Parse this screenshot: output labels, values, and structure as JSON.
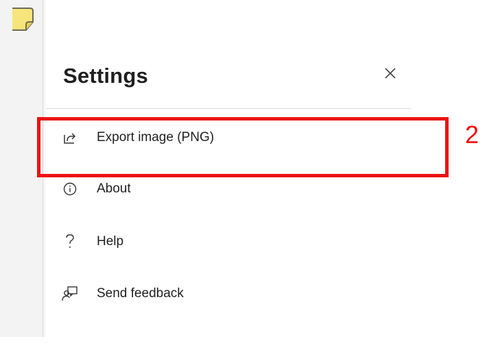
{
  "panel": {
    "title": "Settings",
    "close_icon": "close-icon"
  },
  "menu": {
    "items": [
      {
        "label": "Export image (PNG)",
        "icon": "export-icon"
      },
      {
        "label": "About",
        "icon": "info-icon"
      },
      {
        "label": "Help",
        "icon": "help-icon"
      },
      {
        "label": "Send feedback",
        "icon": "feedback-icon"
      }
    ]
  },
  "annotation": {
    "number": "2",
    "color": "#ee1111"
  },
  "app": {
    "icon": "sticky-note-icon",
    "note_color": "#f7e47a"
  }
}
